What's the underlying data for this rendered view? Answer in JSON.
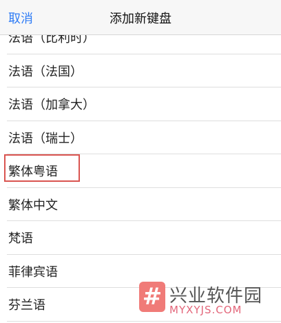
{
  "nav": {
    "cancel_label": "取消",
    "title": "添加新键盘"
  },
  "list": {
    "items": [
      {
        "label": "法语（比利时）"
      },
      {
        "label": "法语（法国）"
      },
      {
        "label": "法语（加拿大）"
      },
      {
        "label": "法语（瑞士）"
      },
      {
        "label": "繁体粤语"
      },
      {
        "label": "繁体中文"
      },
      {
        "label": "梵语"
      },
      {
        "label": "菲律宾语"
      },
      {
        "label": "芬兰语"
      }
    ]
  },
  "watermark": {
    "logo_glyph": "#",
    "title": "兴业软件园",
    "url": "MYXYJS.COM"
  },
  "colors": {
    "accent": "#2f7cf6",
    "highlight": "#d9534f",
    "watermark_pink": "#f07b78"
  }
}
